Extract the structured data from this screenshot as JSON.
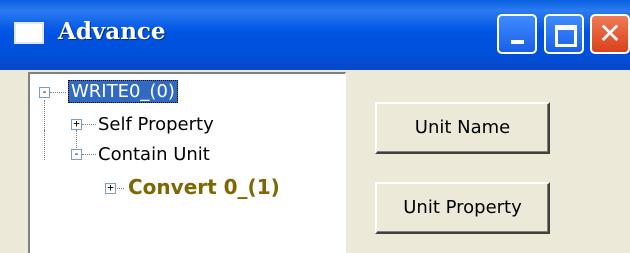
{
  "window": {
    "title": "Advance"
  },
  "titlebar_buttons": {
    "minimize": "minimize",
    "maximize": "maximize",
    "close": "✕"
  },
  "tree": {
    "root": "WRITE0_(0)",
    "children": [
      {
        "label": "Self Property",
        "expander": "+"
      },
      {
        "label": "Contain Unit",
        "expander": "-",
        "children": [
          {
            "label": "Convert 0_(1)",
            "expander": "+"
          }
        ]
      }
    ],
    "root_expander": "-"
  },
  "buttons": {
    "unit_name": "Unit Name",
    "unit_property": "Unit Property"
  },
  "colors": {
    "titlebar": "#0054e3",
    "selection": "#316ac5",
    "convert_node": "#806600",
    "close_button": "#d8421c"
  }
}
